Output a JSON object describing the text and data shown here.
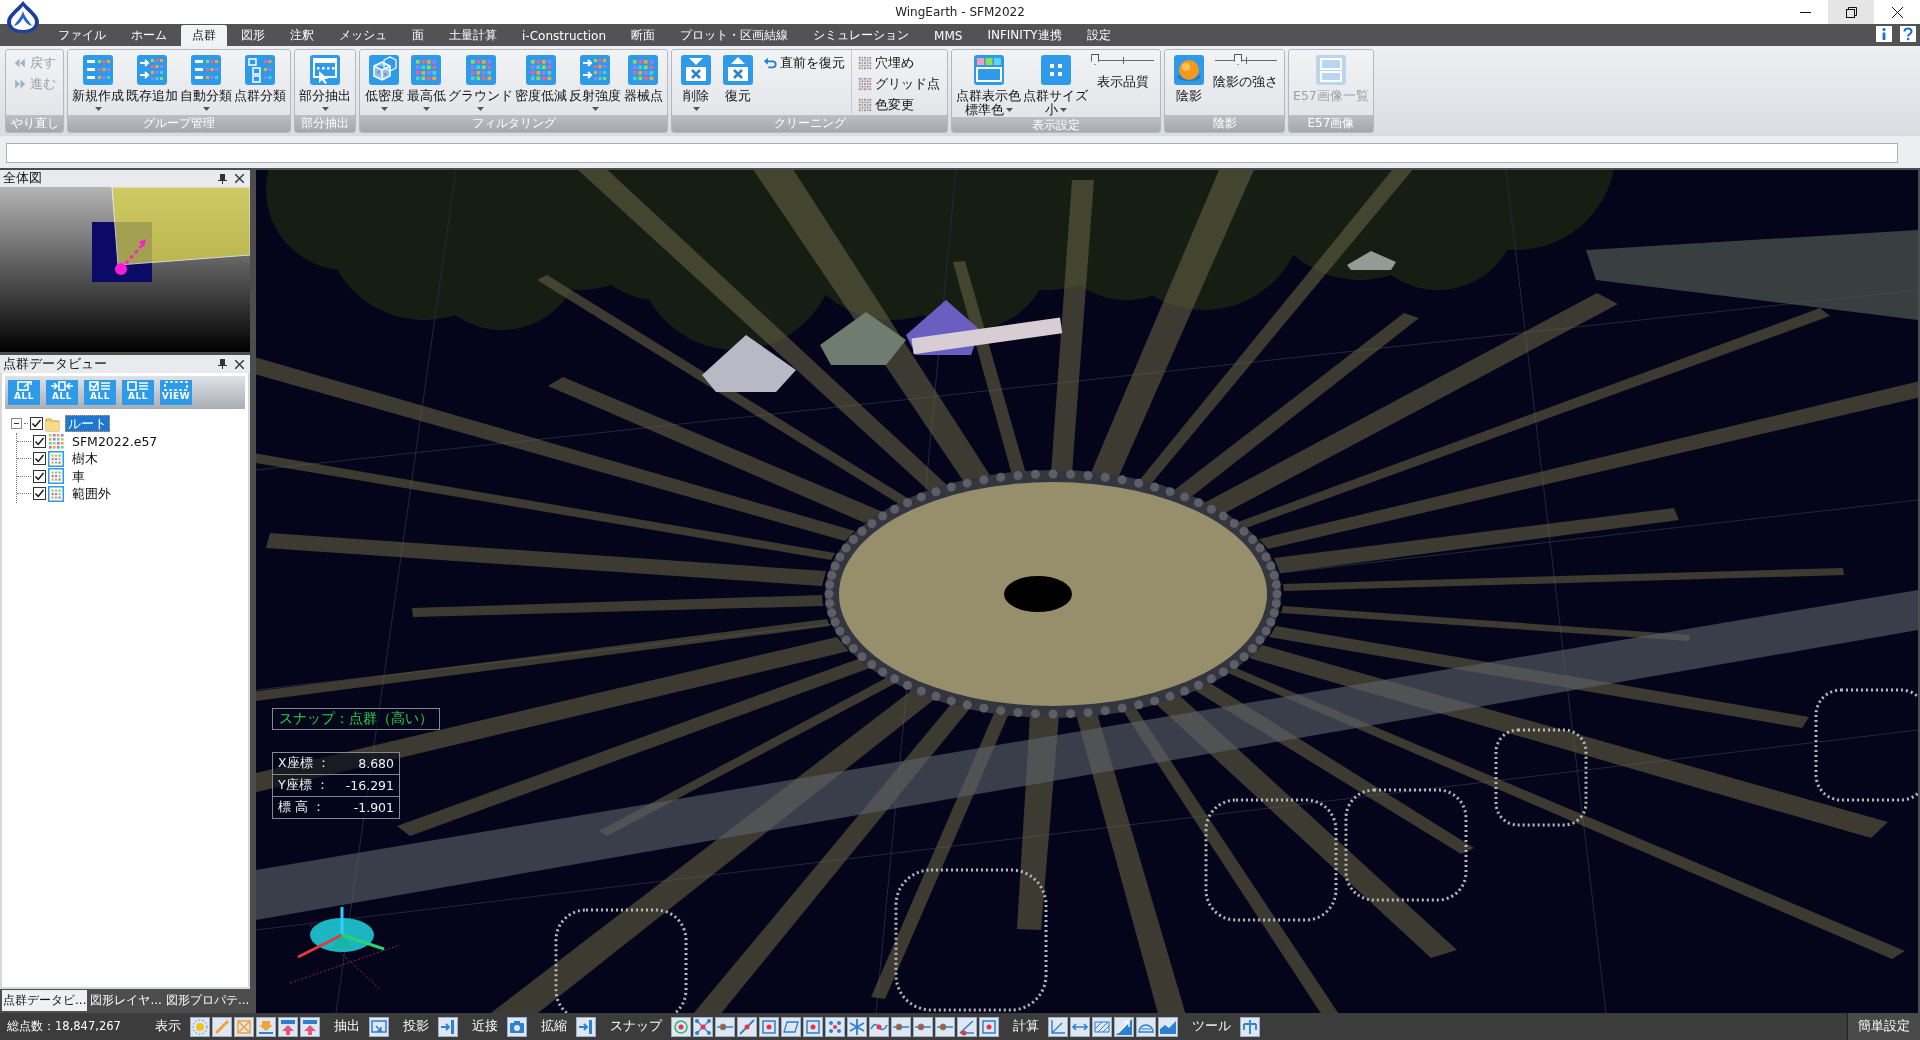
{
  "window": {
    "title": "WingEarth - SFM2022",
    "controls": [
      {
        "kind": "minimize",
        "hovered": false
      },
      {
        "kind": "restore",
        "hovered": true
      },
      {
        "kind": "close",
        "hovered": false
      }
    ]
  },
  "menu_tabs": [
    {
      "label": "ファイル",
      "selected": false
    },
    {
      "label": "ホーム",
      "selected": false
    },
    {
      "label": "点群",
      "selected": true
    },
    {
      "label": "図形",
      "selected": false
    },
    {
      "label": "注釈",
      "selected": false
    },
    {
      "label": "メッシュ",
      "selected": false
    },
    {
      "label": "面",
      "selected": false
    },
    {
      "label": "土量計算",
      "selected": false
    },
    {
      "label": "i-Construction",
      "selected": false
    },
    {
      "label": "断面",
      "selected": false
    },
    {
      "label": "プロット・区画結線",
      "selected": false
    },
    {
      "label": "シミュレーション",
      "selected": false
    },
    {
      "label": "MMS",
      "selected": false
    },
    {
      "label": "INFINITY連携",
      "selected": false
    },
    {
      "label": "設定",
      "selected": false
    }
  ],
  "ribbon_groups": [
    {
      "label": "やり直し",
      "items": [
        {
          "kind": "stack",
          "items": [
            {
              "label": "戻す",
              "disabled": true
            },
            {
              "label": "進む",
              "disabled": true
            }
          ]
        }
      ]
    },
    {
      "label": "グループ管理",
      "items": [
        {
          "kind": "large",
          "label": "新規作成",
          "dropdown": true,
          "disabled": false
        },
        {
          "kind": "large",
          "label": "既存追加",
          "dropdown": false,
          "disabled": false
        },
        {
          "kind": "large",
          "label": "自動分類",
          "dropdown": true,
          "disabled": false
        },
        {
          "kind": "large",
          "label": "点群分類",
          "dropdown": false,
          "disabled": false
        }
      ]
    },
    {
      "label": "部分抽出",
      "items": [
        {
          "kind": "large",
          "label": "部分抽出",
          "dropdown": true,
          "disabled": false
        }
      ]
    },
    {
      "label": "フィルタリング",
      "items": [
        {
          "kind": "large",
          "label": "低密度",
          "dropdown": true,
          "disabled": false
        },
        {
          "kind": "large",
          "label": "最高低",
          "dropdown": true,
          "disabled": false
        },
        {
          "kind": "large",
          "label": "グラウンド",
          "dropdown": true,
          "disabled": false
        },
        {
          "kind": "large",
          "label": "密度低減",
          "dropdown": false,
          "disabled": false
        },
        {
          "kind": "large",
          "label": "反射強度",
          "dropdown": true,
          "disabled": false
        },
        {
          "kind": "large",
          "label": "器械点",
          "dropdown": false,
          "disabled": false
        }
      ]
    },
    {
      "label": "クリーニング",
      "items": [
        {
          "kind": "large",
          "label": "削除",
          "dropdown": true,
          "disabled": false
        },
        {
          "kind": "large",
          "label": "復元",
          "dropdown": false,
          "disabled": false
        },
        {
          "kind": "stack",
          "items": [
            {
              "label": "直前を復元",
              "disabled": false
            }
          ]
        },
        {
          "kind": "stack",
          "items": [
            {
              "label": "穴埋め",
              "disabled": false
            },
            {
              "label": "グリッド点",
              "disabled": false
            },
            {
              "label": "色変更",
              "disabled": false
            }
          ]
        }
      ]
    },
    {
      "label": "表示設定",
      "items": [
        {
          "kind": "large",
          "label": "点群表示色",
          "sublabel": "標準色",
          "dropdown": true,
          "disabled": false
        },
        {
          "kind": "large",
          "label": "点群サイズ",
          "sublabel": "小",
          "dropdown": true,
          "disabled": false
        },
        {
          "kind": "slider",
          "label": "表示品質",
          "level": 0.05
        }
      ]
    },
    {
      "label": "陰影",
      "items": [
        {
          "kind": "large",
          "label": "陰影",
          "dropdown": false,
          "disabled": false
        },
        {
          "kind": "slider",
          "label": "陰影の強さ",
          "level": 0.38
        }
      ]
    },
    {
      "label": "E57画像",
      "items": [
        {
          "kind": "large",
          "label": "E57画像一覧",
          "dropdown": false,
          "disabled": true
        }
      ]
    }
  ],
  "overview_panel": {
    "title": "全体図"
  },
  "data_panel": {
    "title": "点群データビュー",
    "toolbar": [
      "ALL",
      "ALL",
      "ALL",
      "ALL",
      "VIEW"
    ],
    "tree": [
      {
        "kind": "folder",
        "label": "ルート",
        "checked": true,
        "selected": true,
        "expanded": true,
        "children": [
          {
            "kind": "cloud",
            "label": "SFM2022.e57",
            "checked": true,
            "selected": false
          },
          {
            "kind": "group",
            "label": "樹木",
            "checked": true,
            "selected": false
          },
          {
            "kind": "group",
            "label": "車",
            "checked": true,
            "selected": false
          },
          {
            "kind": "group",
            "label": "範囲外",
            "checked": true,
            "selected": false
          }
        ]
      }
    ]
  },
  "panel_tabs": [
    {
      "label": "点群データビ...",
      "selected": true
    },
    {
      "label": "図形レイヤ...",
      "selected": false
    },
    {
      "label": "図形プロパテ...",
      "selected": false
    }
  ],
  "viewport": {
    "snap_label": "スナップ：点群（高い）",
    "coordinates": [
      {
        "label": "X座標 ：",
        "value": "8.680"
      },
      {
        "label": "Y座標 ：",
        "value": "-16.291"
      },
      {
        "label": "標 高 ：",
        "value": "-1.901"
      }
    ]
  },
  "status_bar": {
    "total_points": "総点数：18,847,267",
    "groups": [
      {
        "label": "表示"
      },
      {
        "label": "抽出"
      },
      {
        "label": "投影"
      },
      {
        "label": "近接"
      },
      {
        "label": "拡縮"
      },
      {
        "label": "スナップ"
      },
      {
        "label": "計算"
      },
      {
        "label": "ツール"
      }
    ],
    "settings_button": "簡単設定"
  }
}
